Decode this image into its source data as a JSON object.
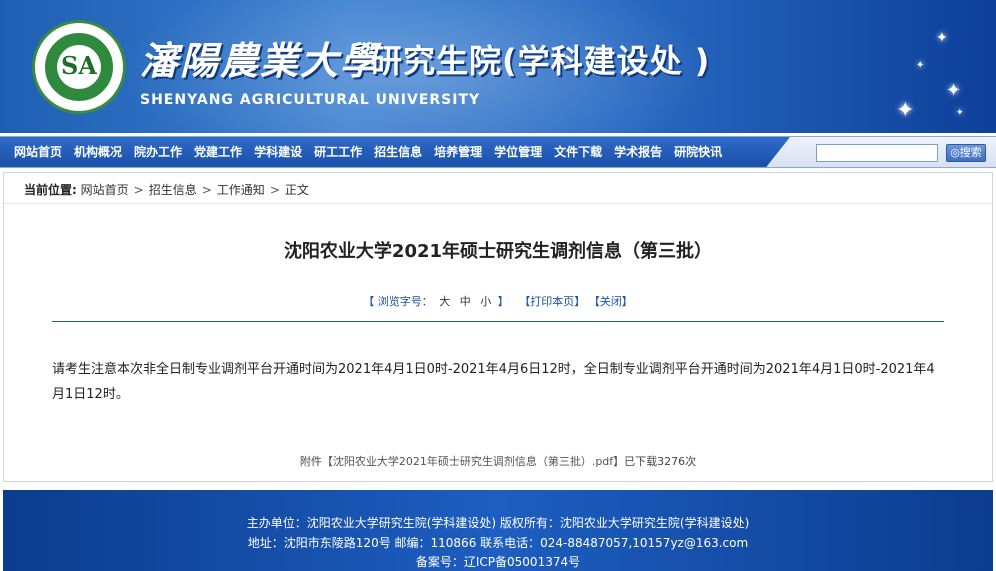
{
  "header": {
    "logo_text": "SA",
    "university_cn": "瀋陽農業大學",
    "institute_title": "研究生院(学科建设处 )",
    "university_en": "SHENYANG AGRICULTURAL UNIVERSITY"
  },
  "nav": {
    "items": [
      "网站首页",
      "机构概况",
      "院办工作",
      "党建工作",
      "学科建设",
      "研工工作",
      "招生信息",
      "培养管理",
      "学位管理",
      "文件下载",
      "学术报告",
      "研院快讯"
    ],
    "search_placeholder": "",
    "search_button": "◎搜索"
  },
  "breadcrumb": {
    "label": "当前位置:",
    "items": [
      "网站首页",
      "招生信息",
      "工作通知",
      "正文"
    ],
    "separator": ">"
  },
  "article": {
    "title": "沈阳农业大学2021年硕士研究生调剂信息（第三批）",
    "toolbar": {
      "open": "【",
      "font_label": "浏览字号：",
      "sizes": [
        "大",
        "中",
        "小"
      ],
      "close": "】",
      "print": "【打印本页】",
      "close_page": "【关闭】"
    },
    "body": "请考生注意本次非全日制专业调剂平台开通时间为2021年4月1日0时-2021年4月6日12时，全日制专业调剂平台开通时间为2021年4月1日0时-2021年4月1日12时。",
    "attachment": {
      "prefix": "附件",
      "link": "【沈阳农业大学2021年硕士研究生调剂信息（第三批）.pdf】",
      "suffix": "已下载3276次"
    }
  },
  "footer": {
    "line1": "主办单位：沈阳农业大学研究生院(学科建设处)   版权所有：沈阳农业大学研究生院(学科建设处)",
    "line2": "地址：沈阳市东陵路120号 邮编：110866   联系电话：024-88487057,10157yz@163.com",
    "line3": "备案号：辽ICP备05001374号"
  }
}
